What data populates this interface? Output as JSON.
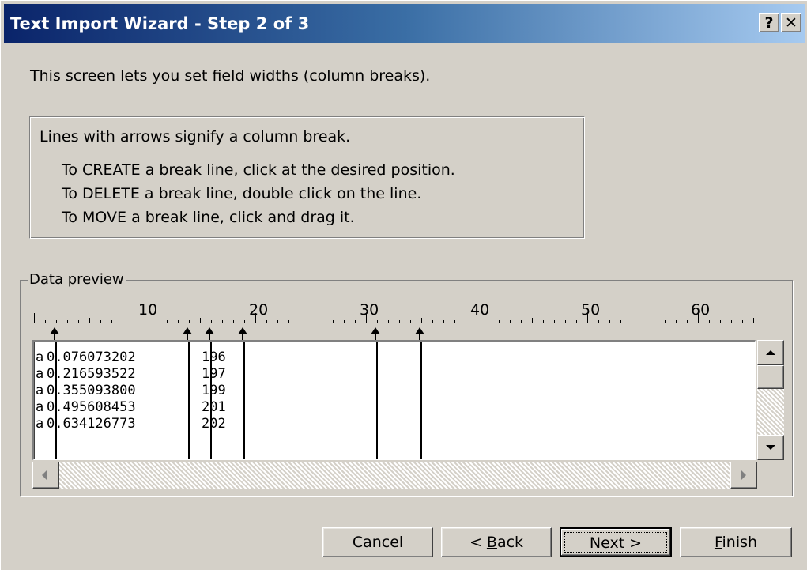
{
  "window": {
    "title": "Text Import Wizard - Step 2 of 3",
    "help_label": "?",
    "close_label": "✕"
  },
  "intro_text": "This screen lets you set field widths (column breaks).",
  "info": {
    "heading": "Lines with arrows signify a column break.",
    "lines": [
      "To CREATE a break line, click at the desired position.",
      "To DELETE a break line, double click on the line.",
      "To MOVE a break line, click and drag it."
    ]
  },
  "data_preview": {
    "label": "Data preview",
    "ruler_labels": [
      "10",
      "20",
      "30",
      "40",
      "50",
      "60"
    ],
    "break_positions": [
      1,
      13,
      15,
      18,
      30,
      34
    ],
    "rows": [
      {
        "col1": "a",
        "col2": " 0.076073202",
        "col3": "196"
      },
      {
        "col1": "a",
        "col2": " 0.216593522",
        "col3": "197"
      },
      {
        "col1": "a",
        "col2": " 0.355093800",
        "col3": "199"
      },
      {
        "col1": "a",
        "col2": " 0.495608453",
        "col3": "201"
      },
      {
        "col1": "a",
        "col2": " 0.634126773",
        "col3": "202"
      }
    ]
  },
  "buttons": {
    "cancel": "Cancel",
    "back_prefix": "< ",
    "back_mnemonic": "B",
    "back_rest": "ack",
    "next": "Next >",
    "finish_mnemonic": "F",
    "finish_rest": "inish"
  }
}
